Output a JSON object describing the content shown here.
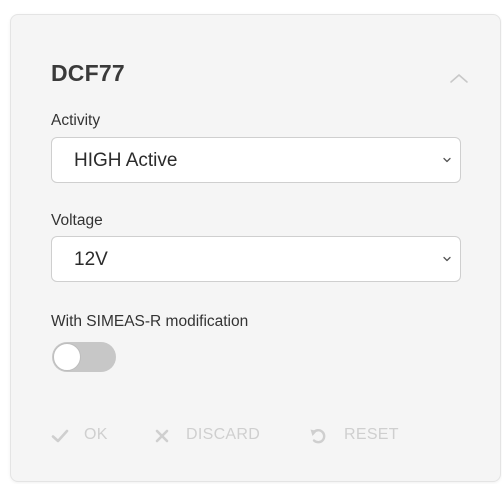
{
  "panel": {
    "title": "DCF77",
    "collapse_icon": "chevron-up-icon"
  },
  "activity": {
    "label": "Activity",
    "value": "HIGH Active"
  },
  "voltage": {
    "label": "Voltage",
    "value": "12V"
  },
  "simeas": {
    "label": "With SIMEAS-R modification",
    "enabled": false
  },
  "actions": {
    "ok_label": "OK",
    "discard_label": "DISCARD",
    "reset_label": "RESET"
  },
  "colors": {
    "card_background": "#f5f5f5",
    "disabled_text": "#cfcfcf",
    "toggle_off": "#c7c7c7"
  }
}
